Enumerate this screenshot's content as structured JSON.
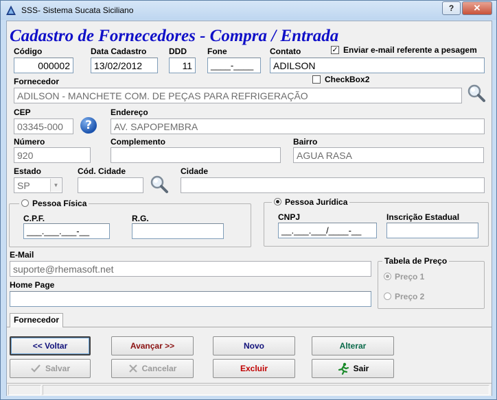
{
  "window": {
    "title": "SSS- Sistema Sucata Siciliano",
    "help": "?",
    "close": "✕"
  },
  "form_title": "Cadastro de Fornecedores - Compra / Entrada",
  "fields": {
    "codigo": {
      "label": "Código",
      "value": "000002"
    },
    "data_cadastro": {
      "label": "Data Cadastro",
      "value": "13/02/2012"
    },
    "ddd": {
      "label": "DDD",
      "value": "11"
    },
    "fone": {
      "label": "Fone",
      "value": "____-____"
    },
    "contato": {
      "label": "Contato",
      "value": "ADILSON"
    },
    "fornecedor": {
      "label": "Fornecedor",
      "value": "ADILSON - MANCHETE COM. DE PEÇAS PARA REFRIGERAÇÃO"
    },
    "cep": {
      "label": "CEP",
      "value": "03345-000"
    },
    "endereco": {
      "label": "Endereço",
      "value": "AV. SAPOPEMBRA"
    },
    "numero": {
      "label": "Número",
      "value": "920"
    },
    "complemento": {
      "label": "Complemento",
      "value": ""
    },
    "bairro": {
      "label": "Bairro",
      "value": "AGUA RASA"
    },
    "estado": {
      "label": "Estado",
      "value": "SP"
    },
    "cod_cidade": {
      "label": "Cód. Cidade",
      "value": ""
    },
    "cidade": {
      "label": "Cidade",
      "value": ""
    },
    "cpf": {
      "label": "C.P.F.",
      "value": "___.___.___-__"
    },
    "rg": {
      "label": "R.G.",
      "value": ""
    },
    "cnpj": {
      "label": "CNPJ",
      "value": "__.___.___/____-__"
    },
    "inscricao_estadual": {
      "label": "Inscrição Estadual",
      "value": ""
    },
    "email": {
      "label": "E-Mail",
      "value": "suporte@rhemasoft.net"
    },
    "home_page": {
      "label": "Home Page",
      "value": ""
    }
  },
  "checkboxes": {
    "enviar_email": {
      "label": "Enviar e-mail referente a pesagem",
      "checked": true
    },
    "checkbox2": {
      "label": "CheckBox2",
      "checked": false
    }
  },
  "pessoa": {
    "fisica": {
      "label": "Pessoa Física",
      "selected": false
    },
    "juridica": {
      "label": "Pessoa Jurídica",
      "selected": true
    }
  },
  "tabela_preco": {
    "label": "Tabela de Preço",
    "options": [
      {
        "label": "Preço 1",
        "selected": true
      },
      {
        "label": "Preço 2",
        "selected": false
      }
    ]
  },
  "tab": {
    "label": "Fornecedor"
  },
  "buttons": {
    "voltar": {
      "label": "<< Voltar",
      "color": "#10107a"
    },
    "avancar": {
      "label": "Avançar >>",
      "color": "#8a1010"
    },
    "novo": {
      "label": "Novo",
      "color": "#10107a"
    },
    "alterar": {
      "label": "Alterar",
      "color": "#0a6a4a"
    },
    "salvar": {
      "label": "Salvar"
    },
    "cancelar": {
      "label": "Cancelar"
    },
    "excluir": {
      "label": "Excluir",
      "color": "#c00000"
    },
    "sair": {
      "label": "Sair"
    }
  },
  "icons": {
    "app": "app-logo-icon",
    "search": "magnifier-icon",
    "help": "question-icon",
    "save": "checkmark-icon",
    "cancel": "x-icon",
    "exit": "running-man-icon"
  }
}
